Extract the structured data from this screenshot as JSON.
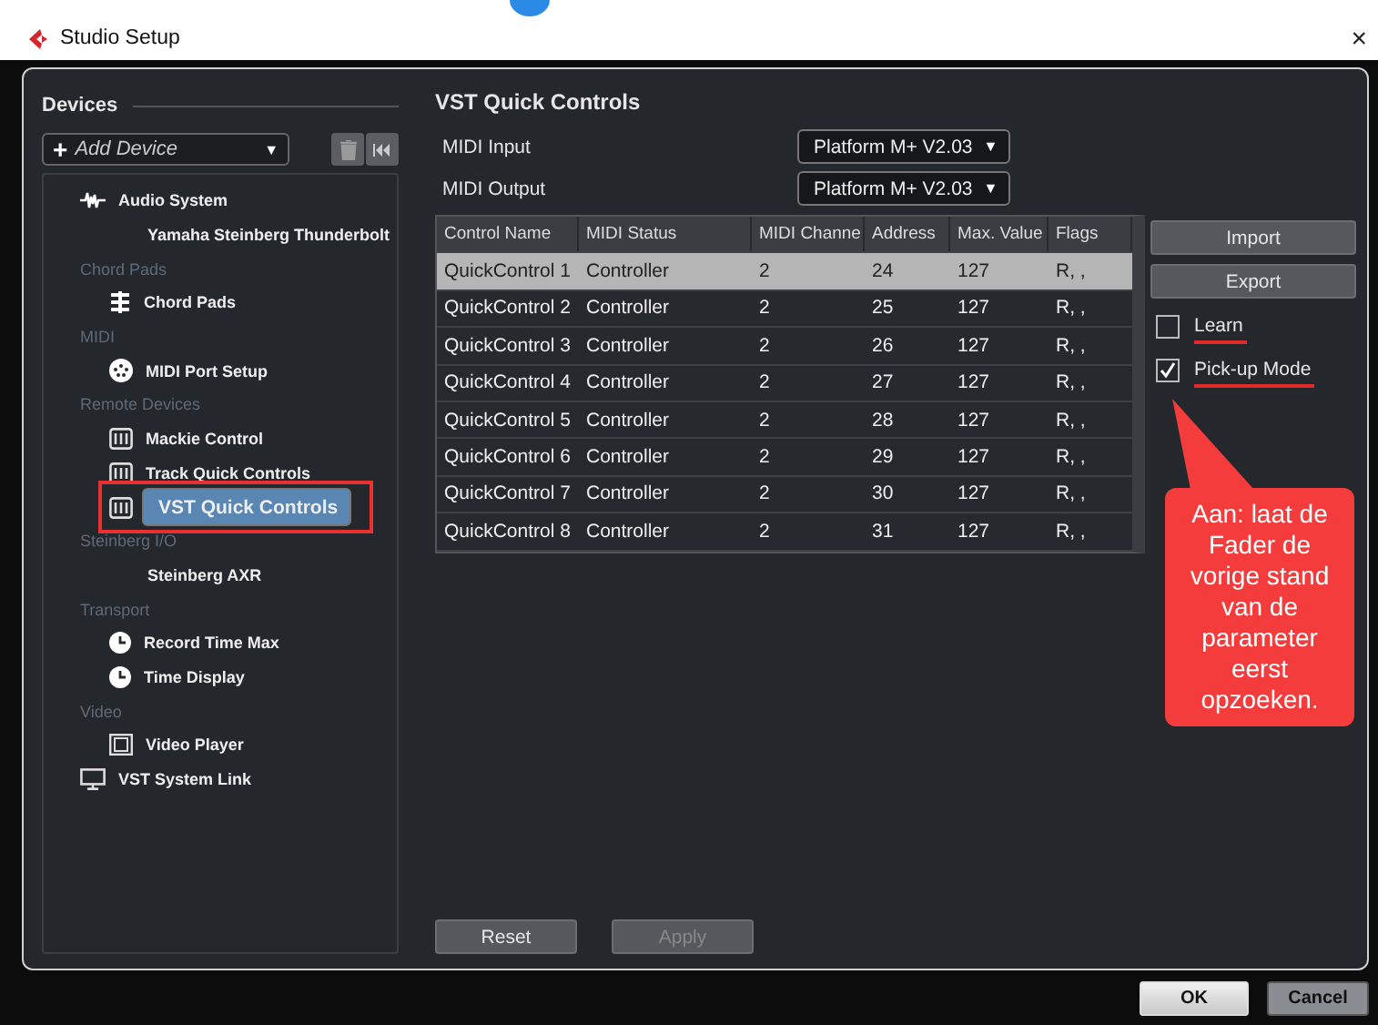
{
  "window": {
    "title": "Studio Setup",
    "close": "×"
  },
  "devices": {
    "title": "Devices",
    "add_device": "Add Device",
    "add_icon": "+",
    "dropdown_icon": "▼",
    "tree": [
      {
        "label": "Audio System",
        "kind": "wave",
        "selected": false,
        "highlighted": false,
        "children": [
          {
            "label": "Yamaha Steinberg Thunderbolt",
            "kind": "plain",
            "selected": false,
            "highlighted": false
          }
        ]
      },
      {
        "label": "Chord Pads",
        "kind": "header",
        "children": [
          {
            "label": "Chord Pads",
            "kind": "pads",
            "selected": false,
            "highlighted": false
          }
        ]
      },
      {
        "label": "MIDI",
        "kind": "header",
        "children": [
          {
            "label": "MIDI Port Setup",
            "kind": "port",
            "selected": false,
            "highlighted": false
          }
        ]
      },
      {
        "label": "Remote Devices",
        "kind": "header",
        "children": [
          {
            "label": "Mackie Control",
            "kind": "remote",
            "selected": false,
            "highlighted": false
          },
          {
            "label": "Track Quick Controls",
            "kind": "remote",
            "selected": false,
            "highlighted": false
          },
          {
            "label": "VST Quick Controls",
            "kind": "remote",
            "selected": true,
            "highlighted": true
          }
        ]
      },
      {
        "label": "Steinberg I/O",
        "kind": "header",
        "children": [
          {
            "label": "Steinberg AXR",
            "kind": "plain",
            "selected": false,
            "highlighted": false
          }
        ]
      },
      {
        "label": "Transport",
        "kind": "header",
        "children": [
          {
            "label": "Record Time Max",
            "kind": "clock",
            "selected": false,
            "highlighted": false
          },
          {
            "label": "Time Display",
            "kind": "clock",
            "selected": false,
            "highlighted": false
          }
        ]
      },
      {
        "label": "Video",
        "kind": "header",
        "children": [
          {
            "label": "Video Player",
            "kind": "film",
            "selected": false,
            "highlighted": false
          }
        ]
      },
      {
        "label": "VST System Link",
        "kind": "monitor",
        "selected": false,
        "highlighted": false
      }
    ]
  },
  "panel": {
    "title": "VST Quick Controls",
    "ports": [
      {
        "label": "MIDI Input",
        "value": "Platform M+ V2.03",
        "arrow": "▼"
      },
      {
        "label": "MIDI Output",
        "value": "Platform M+ V2.03",
        "arrow": "▼"
      }
    ],
    "table": {
      "columns": [
        "Control Name",
        "MIDI Status",
        "MIDI Channe",
        "Address",
        "Max. Value",
        "Flags"
      ],
      "rows": [
        {
          "cells": [
            "QuickControl 1",
            "Controller",
            "2",
            "24",
            "127",
            "R, ,"
          ],
          "selected": true
        },
        {
          "cells": [
            "QuickControl 2",
            "Controller",
            "2",
            "25",
            "127",
            "R, ,"
          ],
          "selected": false
        },
        {
          "cells": [
            "QuickControl 3",
            "Controller",
            "2",
            "26",
            "127",
            "R, ,"
          ],
          "selected": false
        },
        {
          "cells": [
            "QuickControl 4",
            "Controller",
            "2",
            "27",
            "127",
            "R, ,"
          ],
          "selected": false
        },
        {
          "cells": [
            "QuickControl 5",
            "Controller",
            "2",
            "28",
            "127",
            "R, ,"
          ],
          "selected": false
        },
        {
          "cells": [
            "QuickControl 6",
            "Controller",
            "2",
            "29",
            "127",
            "R, ,"
          ],
          "selected": false
        },
        {
          "cells": [
            "QuickControl 7",
            "Controller",
            "2",
            "30",
            "127",
            "R, ,"
          ],
          "selected": false
        },
        {
          "cells": [
            "QuickControl 8",
            "Controller",
            "2",
            "31",
            "127",
            "R, ,"
          ],
          "selected": false
        }
      ]
    },
    "side_buttons": [
      "Import",
      "Export"
    ],
    "options": [
      {
        "label": "Learn",
        "checked": false,
        "underlined": true
      },
      {
        "label": "Pick-up Mode",
        "checked": true,
        "underlined": true
      }
    ],
    "callout": "Aan: laat de Fader de vorige stand van de parameter eerst opzoeken.",
    "bottom_buttons": [
      {
        "label": "Reset",
        "disabled": false
      },
      {
        "label": "Apply",
        "disabled": true
      }
    ]
  },
  "footer": {
    "buttons": [
      {
        "label": "OK",
        "kind": "default"
      },
      {
        "label": "Cancel",
        "kind": "normal"
      }
    ]
  }
}
